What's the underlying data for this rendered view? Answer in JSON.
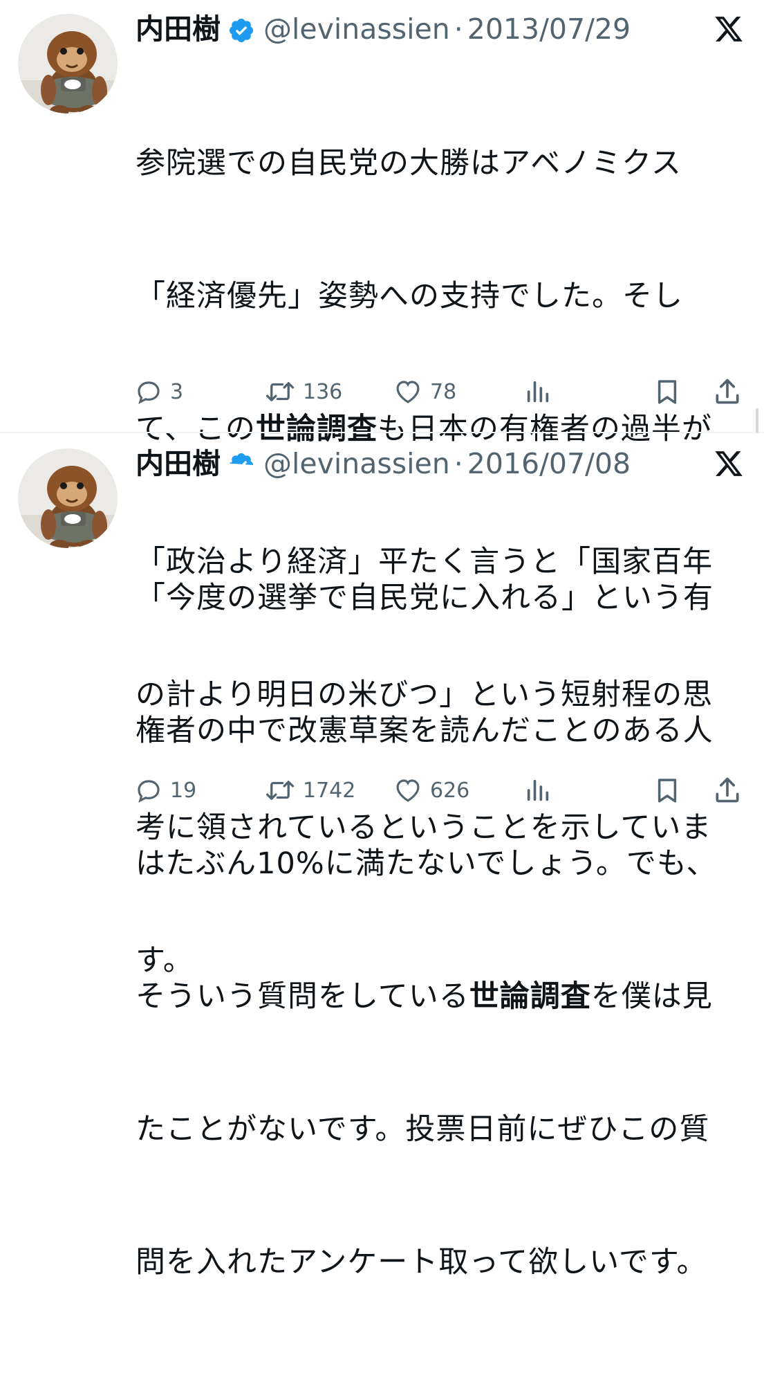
{
  "tweets": [
    {
      "author": {
        "name": "内田樹",
        "handle": "@levinassien",
        "verified": true,
        "avatar": "orangutan-plush-avatar"
      },
      "separator": "·",
      "date": "2013/07/29",
      "lines": [
        [
          "参院選での自民党の大勝はアベノミクス"
        ],
        [
          "「経済優先」姿勢への支持でした。そし"
        ],
        [
          "て、この",
          {
            "bold": "世論調査"
          },
          "も日本の有権者の過半が"
        ],
        [
          "「政治より経済」平たく言うと「国家百年"
        ],
        [
          "の計より明日の米びつ」という短射程の思"
        ],
        [
          "考に領されているということを示していま"
        ],
        [
          "す。"
        ]
      ],
      "stats": {
        "replies": "3",
        "reposts": "136",
        "likes": "78",
        "views": "",
        "bookmark": "",
        "share": ""
      }
    },
    {
      "author": {
        "name": "内田樹",
        "handle": "@levinassien",
        "verified": true,
        "avatar": "orangutan-plush-avatar"
      },
      "separator": "·",
      "date": "2016/07/08",
      "lines": [
        [
          "「今度の選挙で自民党に入れる」という有"
        ],
        [
          "権者の中で改憲草案を読んだことのある人"
        ],
        [
          "はたぶん10%に満たないでしょう。でも、"
        ],
        [
          "そういう質問をしている",
          {
            "bold": "世論調査"
          },
          "を僕は見"
        ],
        [
          "たことがないです。投票日前にぜひこの質"
        ],
        [
          "問を入れたアンケート取って欲しいです。"
        ]
      ],
      "stats": {
        "replies": "19",
        "reposts": "1742",
        "likes": "626",
        "views": "",
        "bookmark": "",
        "share": ""
      }
    }
  ],
  "icons": {
    "verified": "verified-badge-icon",
    "platform_logo": "x-logo-icon",
    "reply": "reply-icon",
    "repost": "repost-icon",
    "like": "like-icon",
    "views": "views-icon",
    "bookmark": "bookmark-icon",
    "share": "share-icon"
  },
  "colors": {
    "text": "#0f1419",
    "secondary": "#536471",
    "verified_blue": "#1d9bf0",
    "divider": "#eff3f4"
  }
}
